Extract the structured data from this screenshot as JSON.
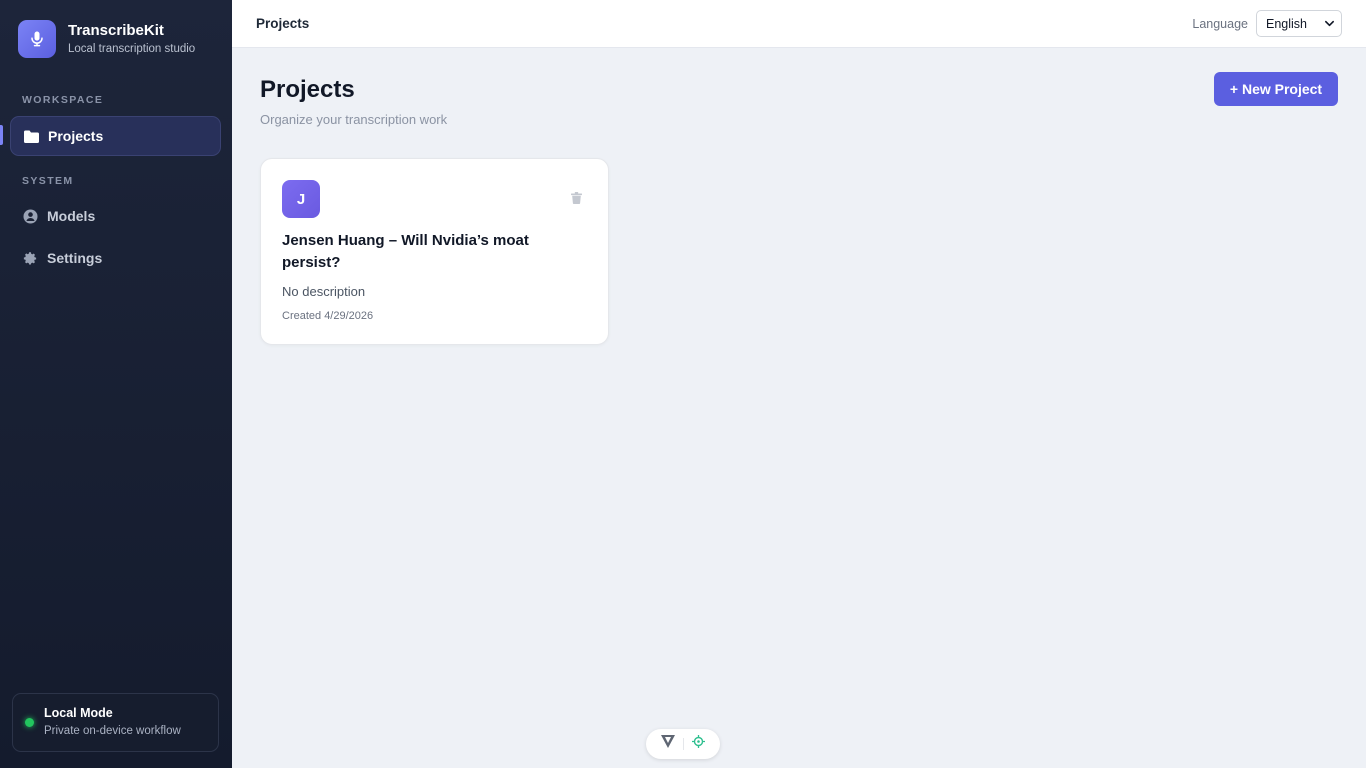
{
  "brand": {
    "name": "TranscribeKit",
    "subtitle": "Local transcription studio"
  },
  "sidebar": {
    "sections": [
      {
        "label": "WORKSPACE",
        "items": [
          {
            "label": "Projects",
            "icon": "folder-icon",
            "active": true
          }
        ]
      },
      {
        "label": "SYSTEM",
        "items": [
          {
            "label": "Models",
            "icon": "user-circle-icon"
          },
          {
            "label": "Settings",
            "icon": "gear-icon"
          }
        ]
      }
    ],
    "status": {
      "title": "Local Mode",
      "subtitle": "Private on-device workflow",
      "color": "#22c55e"
    }
  },
  "topbar": {
    "title": "Projects",
    "language_label": "Language",
    "language_value": "English"
  },
  "main": {
    "title": "Projects",
    "subtitle": "Organize your transcription work",
    "new_button": "+ New Project",
    "projects": [
      {
        "initial": "J",
        "title": "Jensen Huang – Will Nvidia’s moat persist?",
        "description": "No description",
        "created": "Created 4/29/2026"
      }
    ]
  },
  "colors": {
    "accent": "#5b5fe0",
    "sidebar_bg": "#1a2134"
  }
}
